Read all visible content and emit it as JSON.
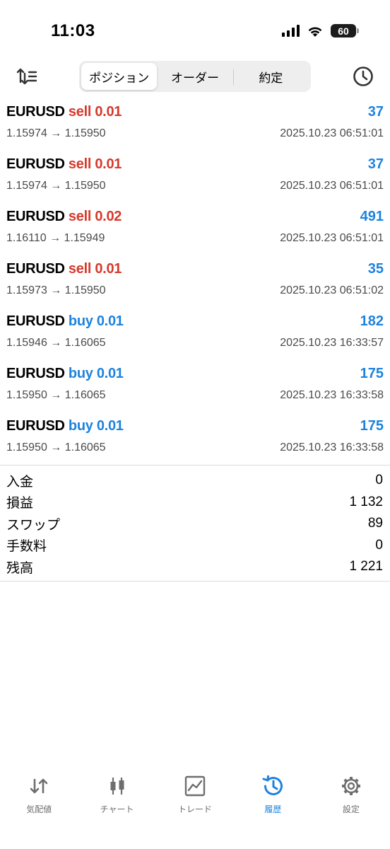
{
  "status_bar": {
    "time": "11:03",
    "battery": "60"
  },
  "toolbar": {
    "sort_icon": "sort-icon",
    "history_icon": "clock-icon",
    "segments": [
      {
        "label": "ポジション",
        "active": true
      },
      {
        "label": "オーダー",
        "active": false
      },
      {
        "label": "約定",
        "active": false
      }
    ]
  },
  "trades": [
    {
      "symbol": "EURUSD",
      "side": "sell",
      "volume": "0.01",
      "profit": "37",
      "prices": "1.15974 → 1.15950",
      "time": "2025.10.23 06:51:01"
    },
    {
      "symbol": "EURUSD",
      "side": "sell",
      "volume": "0.01",
      "profit": "37",
      "prices": "1.15974 → 1.15950",
      "time": "2025.10.23 06:51:01"
    },
    {
      "symbol": "EURUSD",
      "side": "sell",
      "volume": "0.02",
      "profit": "491",
      "prices": "1.16110 → 1.15949",
      "time": "2025.10.23 06:51:01"
    },
    {
      "symbol": "EURUSD",
      "side": "sell",
      "volume": "0.01",
      "profit": "35",
      "prices": "1.15973 → 1.15950",
      "time": "2025.10.23 06:51:02"
    },
    {
      "symbol": "EURUSD",
      "side": "buy",
      "volume": "0.01",
      "profit": "182",
      "prices": "1.15946 → 1.16065",
      "time": "2025.10.23 16:33:57"
    },
    {
      "symbol": "EURUSD",
      "side": "buy",
      "volume": "0.01",
      "profit": "175",
      "prices": "1.15950 → 1.16065",
      "time": "2025.10.23 16:33:58"
    },
    {
      "symbol": "EURUSD",
      "side": "buy",
      "volume": "0.01",
      "profit": "175",
      "prices": "1.15950 → 1.16065",
      "time": "2025.10.23 16:33:58"
    }
  ],
  "summary": [
    {
      "label": "入金",
      "value": "0"
    },
    {
      "label": "損益",
      "value": "1 132"
    },
    {
      "label": "スワップ",
      "value": "89"
    },
    {
      "label": "手数料",
      "value": "0"
    },
    {
      "label": "残高",
      "value": "1 221"
    }
  ],
  "tabbar": [
    {
      "label": "気配値",
      "icon": "quotes-icon",
      "active": false
    },
    {
      "label": "チャート",
      "icon": "chart-icon",
      "active": false
    },
    {
      "label": "トレード",
      "icon": "trade-icon",
      "active": false
    },
    {
      "label": "履歴",
      "icon": "history-icon",
      "active": true
    },
    {
      "label": "設定",
      "icon": "settings-icon",
      "active": false
    }
  ],
  "colors": {
    "sell": "#d63a2c",
    "buy": "#1d83de",
    "profit": "#1d83de",
    "active_tab": "#1d83de"
  }
}
